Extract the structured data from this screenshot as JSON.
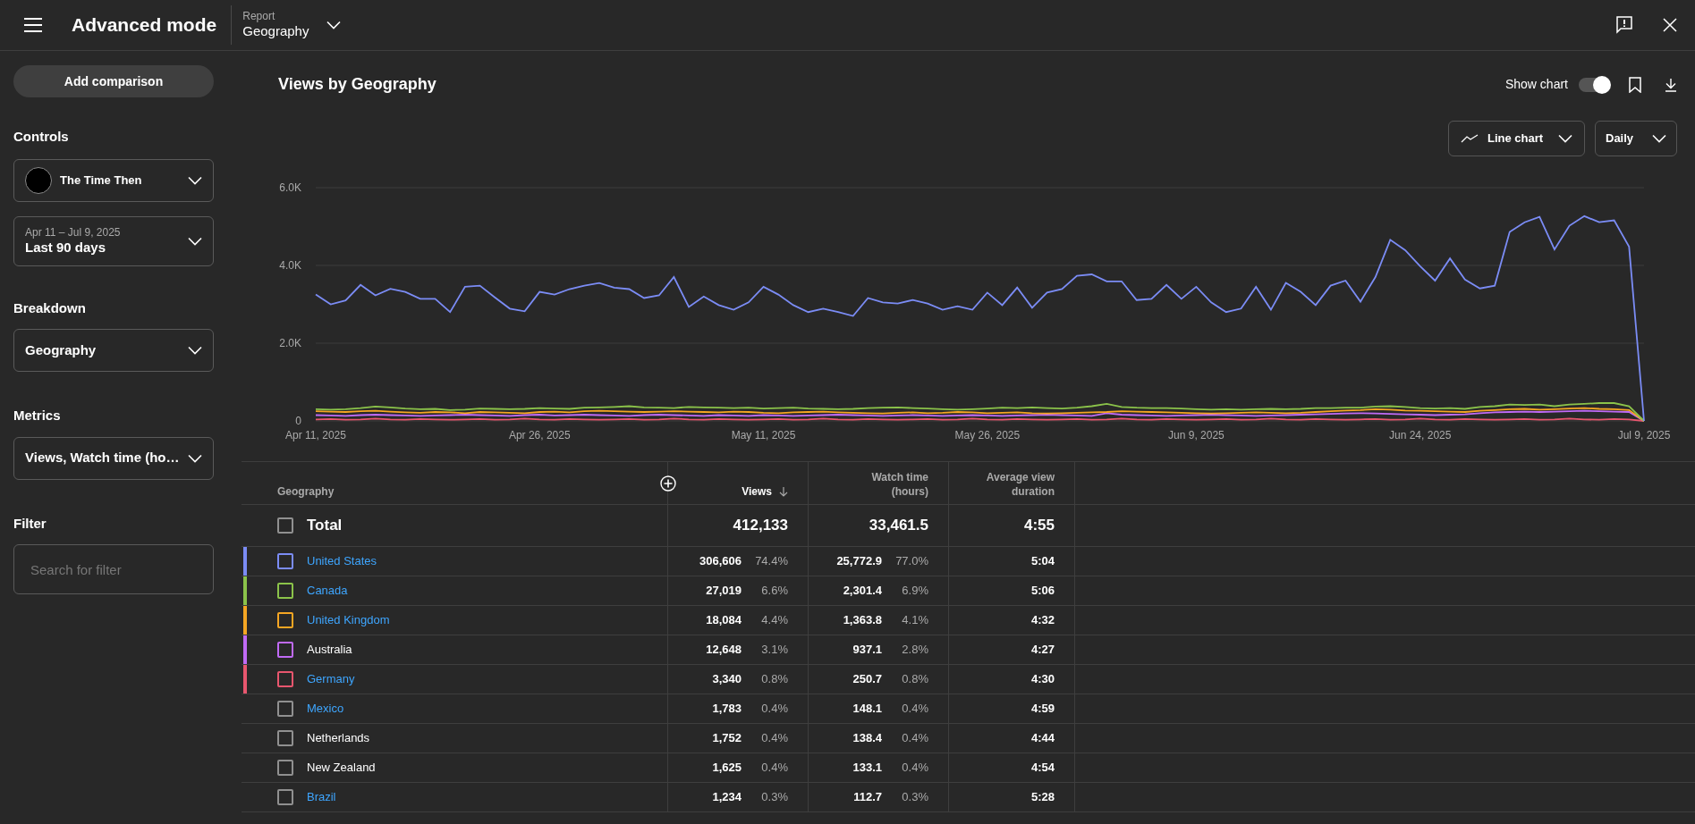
{
  "topbar": {
    "title": "Advanced mode",
    "report_label": "Report",
    "report_value": "Geography"
  },
  "sidebar": {
    "add_button": "Add comparison",
    "controls_heading": "Controls",
    "channel": "The Time Then",
    "date_range": {
      "range": "Apr 11 – Jul 9, 2025",
      "label": "Last 90 days"
    },
    "breakdown_heading": "Breakdown",
    "breakdown": "Geography",
    "metrics_heading": "Metrics",
    "metrics": "Views, Watch time (ho…",
    "filter_heading": "Filter",
    "filter_placeholder": "Search for filter"
  },
  "main": {
    "title": "Views by Geography",
    "show_chart_label": "Show chart",
    "show_chart": true,
    "chart_type": "Line chart",
    "interval": "Daily",
    "chart_data": {
      "type": "line",
      "ylim": [
        0,
        6000
      ],
      "yticks": [
        {
          "value": 0,
          "label": "0"
        },
        {
          "value": 2000,
          "label": "2.0K"
        },
        {
          "value": 4000,
          "label": "4.0K"
        },
        {
          "value": 6000,
          "label": "6.0K"
        }
      ],
      "categories": [
        "Apr 11, 2025",
        null,
        null,
        null,
        null,
        null,
        null,
        null,
        null,
        null,
        null,
        null,
        null,
        null,
        null,
        "Apr 26, 2025",
        null,
        null,
        null,
        null,
        null,
        null,
        null,
        null,
        null,
        null,
        null,
        null,
        null,
        null,
        "May 11, 2025",
        null,
        null,
        null,
        null,
        null,
        null,
        null,
        null,
        null,
        null,
        null,
        null,
        null,
        null,
        "May 26, 2025",
        null,
        null,
        null,
        null,
        null,
        null,
        null,
        null,
        null,
        null,
        null,
        null,
        null,
        "Jun 9, 2025",
        null,
        null,
        null,
        null,
        null,
        null,
        null,
        null,
        null,
        null,
        null,
        null,
        null,
        null,
        "Jun 24, 2025",
        null,
        null,
        null,
        null,
        null,
        null,
        null,
        null,
        null,
        null,
        null,
        null,
        null,
        null,
        "Jul 9, 2025"
      ],
      "series": [
        {
          "color": "#7b8cf5",
          "values": [
            3250,
            3000,
            3100,
            3500,
            3230,
            3400,
            3320,
            3140,
            3140,
            2800,
            3450,
            3480,
            3180,
            2890,
            2820,
            3320,
            3250,
            3390,
            3480,
            3550,
            3430,
            3390,
            3160,
            3230,
            3700,
            2930,
            3200,
            2980,
            2860,
            3050,
            3450,
            3250,
            2980,
            2800,
            2890,
            2800,
            2700,
            3160,
            3050,
            3020,
            3110,
            3020,
            2860,
            2950,
            2860,
            3300,
            2980,
            3430,
            2910,
            3300,
            3390,
            3730,
            3770,
            3590,
            3590,
            3110,
            3140,
            3500,
            3140,
            3450,
            3050,
            2800,
            2890,
            3450,
            2860,
            3550,
            3320,
            2980,
            3480,
            3610,
            3070,
            3700,
            4660,
            4390,
            3980,
            3610,
            4180,
            3640,
            3410,
            3480,
            4860,
            5110,
            5250,
            4410,
            5020,
            5270,
            5110,
            5160,
            4480,
            0
          ]
        },
        {
          "color": "#8bc34a",
          "values": [
            300,
            290,
            300,
            330,
            370,
            350,
            320,
            300,
            310,
            280,
            290,
            320,
            310,
            300,
            310,
            330,
            320,
            310,
            340,
            350,
            360,
            380,
            350,
            340,
            330,
            360,
            350,
            340,
            330,
            340,
            320,
            330,
            340,
            320,
            310,
            300,
            310,
            330,
            340,
            350,
            330,
            320,
            300,
            290,
            300,
            320,
            340,
            330,
            350,
            330,
            320,
            340,
            380,
            440,
            360,
            340,
            330,
            330,
            320,
            300,
            290,
            300,
            290,
            300,
            310,
            300,
            310,
            330,
            330,
            340,
            340,
            370,
            380,
            360,
            330,
            320,
            330,
            310,
            360,
            380,
            420,
            410,
            420,
            380,
            420,
            440,
            460,
            460,
            380,
            0
          ]
        },
        {
          "color": "#f5a623",
          "values": [
            250,
            240,
            230,
            250,
            260,
            240,
            220,
            210,
            230,
            220,
            200,
            230,
            220,
            210,
            200,
            230,
            240,
            220,
            250,
            260,
            250,
            240,
            230,
            240,
            250,
            240,
            230,
            220,
            240,
            230,
            210,
            200,
            220,
            230,
            240,
            220,
            210,
            200,
            190,
            210,
            220,
            200,
            210,
            230,
            220,
            200,
            210,
            220,
            200,
            190,
            200,
            210,
            220,
            230,
            250,
            240,
            230,
            220,
            210,
            200,
            190,
            200,
            210,
            220,
            210,
            200,
            210,
            230,
            250,
            270,
            280,
            300,
            290,
            270,
            260,
            250,
            240,
            230,
            260,
            280,
            300,
            310,
            290,
            300,
            320,
            330,
            310,
            300,
            280,
            0
          ]
        },
        {
          "color": "#c06af5",
          "values": [
            150,
            140,
            130,
            150,
            160,
            150,
            140,
            130,
            140,
            150,
            160,
            150,
            140,
            130,
            150,
            160,
            140,
            150,
            160,
            150,
            140,
            130,
            150,
            160,
            150,
            140,
            130,
            150,
            140,
            130,
            150,
            140,
            130,
            140,
            150,
            160,
            150,
            140,
            130,
            140,
            150,
            140,
            130,
            140,
            150,
            140,
            130,
            140,
            150,
            160,
            150,
            140,
            130,
            200,
            160,
            150,
            140,
            130,
            140,
            150,
            160,
            150,
            140,
            130,
            140,
            150,
            160,
            170,
            180,
            190,
            200,
            190,
            180,
            170,
            160,
            150,
            160,
            170,
            200,
            220,
            230,
            240,
            230,
            240,
            250,
            260,
            250,
            240,
            230,
            0
          ]
        },
        {
          "color": "#e8566e",
          "values": [
            40,
            50,
            30,
            40,
            60,
            40,
            30,
            50,
            40,
            30,
            40,
            50,
            30,
            40,
            60,
            40,
            30,
            50,
            40,
            30,
            40,
            50,
            30,
            40,
            60,
            40,
            30,
            50,
            40,
            30,
            40,
            50,
            30,
            40,
            60,
            40,
            30,
            50,
            40,
            30,
            40,
            50,
            30,
            40,
            60,
            40,
            30,
            50,
            40,
            30,
            40,
            50,
            30,
            40,
            60,
            40,
            30,
            50,
            40,
            30,
            40,
            50,
            30,
            40,
            60,
            40,
            30,
            50,
            40,
            30,
            40,
            50,
            30,
            40,
            60,
            40,
            30,
            50,
            40,
            30,
            40,
            50,
            30,
            40,
            60,
            40,
            30,
            50,
            40,
            0
          ]
        }
      ]
    }
  },
  "table": {
    "columns": [
      {
        "label": "Geography",
        "sorted": false
      },
      {
        "label": "Views",
        "sorted": true
      },
      {
        "label": "Watch time (hours)",
        "sorted": false
      },
      {
        "label": "Average view duration",
        "sorted": false
      }
    ],
    "total": {
      "label": "Total",
      "checked": false,
      "views": "412,133",
      "watch_time": "33,461.5",
      "avg_duration": "4:55"
    },
    "rows": [
      {
        "name": "United States",
        "link": true,
        "color": "#7b8cf5",
        "checked": false,
        "views": "306,606",
        "views_share": "74.4%",
        "watch_time": "25,772.9",
        "watch_share": "77.0%",
        "avg_duration": "5:04"
      },
      {
        "name": "Canada",
        "link": true,
        "color": "#8bc34a",
        "checked": false,
        "views": "27,019",
        "views_share": "6.6%",
        "watch_time": "2,301.4",
        "watch_share": "6.9%",
        "avg_duration": "5:06"
      },
      {
        "name": "United Kingdom",
        "link": true,
        "color": "#f5a623",
        "checked": false,
        "views": "18,084",
        "views_share": "4.4%",
        "watch_time": "1,363.8",
        "watch_share": "4.1%",
        "avg_duration": "4:32"
      },
      {
        "name": "Australia",
        "link": false,
        "color": "#c06af5",
        "checked": false,
        "views": "12,648",
        "views_share": "3.1%",
        "watch_time": "937.1",
        "watch_share": "2.8%",
        "avg_duration": "4:27"
      },
      {
        "name": "Germany",
        "link": true,
        "color": "#e8566e",
        "checked": false,
        "views": "3,340",
        "views_share": "0.8%",
        "watch_time": "250.7",
        "watch_share": "0.8%",
        "avg_duration": "4:30"
      },
      {
        "name": "Mexico",
        "link": true,
        "checked": false,
        "views": "1,783",
        "views_share": "0.4%",
        "watch_time": "148.1",
        "watch_share": "0.4%",
        "avg_duration": "4:59"
      },
      {
        "name": "Netherlands",
        "link": false,
        "checked": false,
        "views": "1,752",
        "views_share": "0.4%",
        "watch_time": "138.4",
        "watch_share": "0.4%",
        "avg_duration": "4:44"
      },
      {
        "name": "New Zealand",
        "link": false,
        "checked": false,
        "views": "1,625",
        "views_share": "0.4%",
        "watch_time": "133.1",
        "watch_share": "0.4%",
        "avg_duration": "4:54"
      },
      {
        "name": "Brazil",
        "link": true,
        "checked": false,
        "views": "1,234",
        "views_share": "0.3%",
        "watch_time": "112.7",
        "watch_share": "0.3%",
        "avg_duration": "5:28"
      }
    ]
  }
}
